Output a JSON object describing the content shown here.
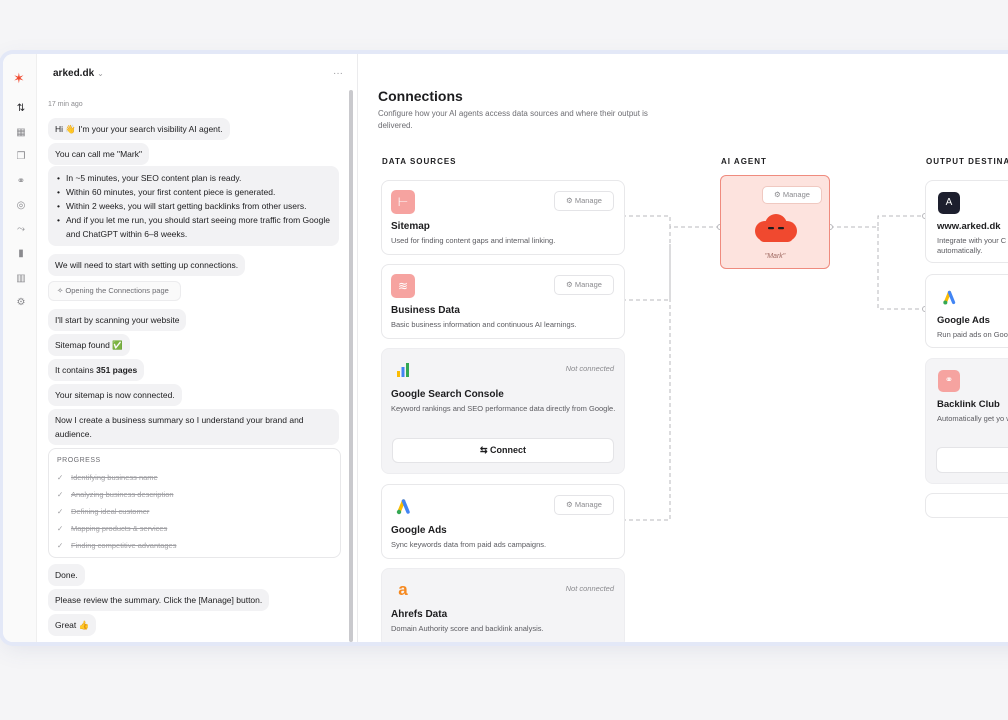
{
  "sidebar": {
    "logo": "logo-icon",
    "icons": [
      "connections-icon",
      "calendar-icon",
      "documents-icon",
      "nodes-icon",
      "database-icon",
      "flow-icon",
      "chart-icon",
      "library-icon",
      "settings-icon"
    ]
  },
  "chat": {
    "workspace": "arked.dk",
    "more": "···",
    "timestamp": "17 min ago",
    "messages": {
      "m1": "Hi 👋 I'm your your search visibility AI agent.",
      "m2": "You can call me \"Mark\"",
      "bullets": [
        "In ~5 minutes, your SEO content plan is ready.",
        "Within 60 minutes, your first content piece is generated.",
        "Within 2 weeks, you will start getting backlinks from other users.",
        "And if you let me run, you should start seeing more traffic from Google and ChatGPT within 6–8 weeks."
      ],
      "m4": "We will need to start with setting up connections.",
      "tool": "Opening the Connections page",
      "m5": "I'll start by scanning your website",
      "m6": "Sitemap found ✅",
      "m7_prefix": "It contains ",
      "m7_bold": "351 pages",
      "m8": "Your sitemap is now connected.",
      "m9": "Now I create a business summary so I understand your brand and audience.",
      "m10": "Done.",
      "m11": "Please review the summary. Click the [Manage] button.",
      "m12": "Great 👍"
    },
    "progress": {
      "title": "PROGRESS",
      "steps": [
        "Identifying business name",
        "Analyzing business description",
        "Defining ideal customer",
        "Mapping products & services",
        "Finding competitive advantages"
      ]
    }
  },
  "main": {
    "title": "Connections",
    "subtitle": "Configure how your AI agents access data sources and where their output is delivered.",
    "col_sources": "DATA SOURCES",
    "col_agent": "AI AGENT",
    "col_output": "OUTPUT DESTINA",
    "manage": "Manage",
    "not_connected": "Not connected",
    "connect": "Connect",
    "sources": [
      {
        "name": "Sitemap",
        "desc": "Used for finding content gaps and internal linking."
      },
      {
        "name": "Business Data",
        "desc": "Basic business information and continuous AI learnings."
      },
      {
        "name": "Google Search Console",
        "desc": "Keyword rankings and SEO performance data directly from Google."
      },
      {
        "name": "Google Ads",
        "desc": "Sync keywords data from paid ads campaigns."
      },
      {
        "name": "Ahrefs Data",
        "desc": "Domain Authority score and backlink analysis."
      }
    ],
    "agent_name": "\"Mark\"",
    "outputs": [
      {
        "name": "www.arked.dk",
        "desc": "Integrate with your C automatically."
      },
      {
        "name": "Google Ads",
        "desc": "Run paid ads on Goo"
      },
      {
        "name": "Backlink Club",
        "desc": "Automatically get yo websites."
      }
    ]
  }
}
